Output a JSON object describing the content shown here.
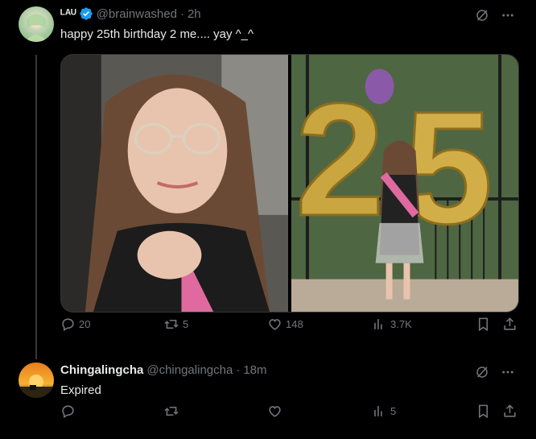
{
  "tweet1": {
    "name": "ᴸᴬᵁ",
    "handle": "@brainwashed",
    "separator": "·",
    "time": "2h",
    "text": "happy 25th birthday 2 me.... yay ^_^",
    "actions": {
      "replies": "20",
      "retweets": "5",
      "likes": "148",
      "views": "3.7K"
    }
  },
  "tweet2": {
    "name": "Chingalingcha",
    "handle": "@chingalingcha",
    "separator": "·",
    "time": "18m",
    "text": "Expired",
    "actions": {
      "replies": "",
      "retweets": "",
      "likes": "",
      "views": "5"
    }
  },
  "icons": [
    "verified-badge-icon",
    "grok-icon",
    "more-icon",
    "reply-icon",
    "retweet-icon",
    "like-icon",
    "views-icon",
    "bookmark-icon",
    "share-icon"
  ],
  "colors": {
    "accent": "#1d9bf0",
    "muted": "#71767b",
    "text": "#e7e9ea",
    "background": "#000000"
  }
}
